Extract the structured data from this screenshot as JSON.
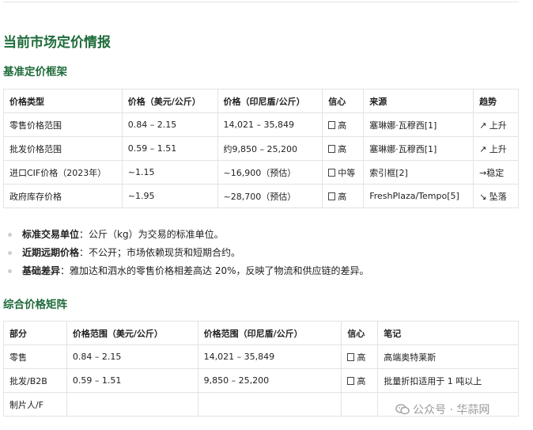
{
  "heading_main": "当前市场定价情报",
  "section1": {
    "title": "基准定价框架",
    "headers": [
      "价格类型",
      "价格（美元/公斤）",
      "价格（印尼盾/公斤）",
      "信心",
      "来源",
      "趋势"
    ],
    "rows": [
      {
        "type": "零售价格范围",
        "usd": "0.84 – 2.15",
        "idr": "14,021 – 35,849",
        "conf": "高",
        "source": "塞琳娜·瓦穆西[1]",
        "trend": "↗ 上升"
      },
      {
        "type": "批发价格范围",
        "usd": "0.59 – 1.51",
        "idr": "约9,850 – 25,200",
        "conf": "高",
        "source": "塞琳娜·瓦穆西[1]",
        "trend": "↗ 上升"
      },
      {
        "type": "进口CIF价格（2023年）",
        "usd": "~1.15",
        "idr": "~16,900（预估）",
        "conf": "中等",
        "source": "索引框[2]",
        "trend": "→稳定"
      },
      {
        "type": "政府库存价格",
        "usd": "~1.95",
        "idr": "~28,700（预估）",
        "conf": "高",
        "source": "FreshPlaza/Tempo[5]",
        "trend": "↘ 坠落"
      }
    ]
  },
  "bullets": [
    {
      "label": "标准交易单位",
      "text": "：公斤（kg）为交易的标准单位。"
    },
    {
      "label": "近期远期价格",
      "text": "：不公开；市场依赖现货和短期合约。"
    },
    {
      "label": "基础差异",
      "text": "：雅加达和泗水的零售价格相差高达 20%，反映了物流和供应链的差异。"
    }
  ],
  "section2": {
    "title": "综合价格矩阵",
    "headers": [
      "部分",
      "价格范围（美元/公斤）",
      "价格范围（印尼盾/公斤）",
      "信心",
      "笔记"
    ],
    "rows": [
      {
        "segment": "零售",
        "usd": "0.84 – 2.15",
        "idr": "14,021 – 35,849",
        "conf": "高",
        "note": "高端奥特莱斯"
      },
      {
        "segment": "批发/B2B",
        "usd": "0.59 – 1.51",
        "idr": "9,850 – 25,200",
        "conf": "高",
        "note": "批量折扣适用于 1 吨以上"
      },
      {
        "segment": "制片人/F",
        "usd": "",
        "idr": "",
        "conf": "",
        "note": ""
      }
    ]
  },
  "watermark": "公众号 · 华蒜网",
  "watermark_icon": "wechat-icon"
}
